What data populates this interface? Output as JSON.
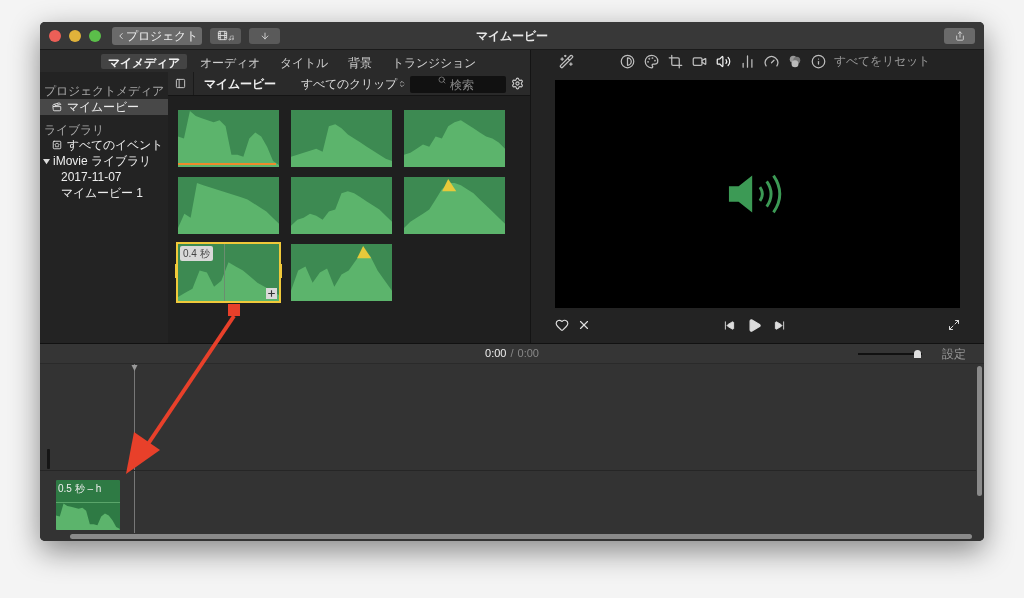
{
  "window": {
    "title": "マイムービー"
  },
  "toolbar": {
    "back_button": "プロジェクト"
  },
  "tabs": [
    {
      "label": "マイメディア",
      "selected": true
    },
    {
      "label": "オーディオ",
      "selected": false
    },
    {
      "label": "タイトル",
      "selected": false
    },
    {
      "label": "背景",
      "selected": false
    },
    {
      "label": "トランジション",
      "selected": false
    }
  ],
  "sidebar": {
    "project_heading": "プロジェクトメディア",
    "project_items": [
      {
        "label": "マイムービー",
        "selected": true
      }
    ],
    "library_heading": "ライブラリ",
    "events_item": {
      "label": "すべてのイベント",
      "selected": false
    },
    "tree": [
      {
        "label": "iMovie ライブラリ",
        "expanded": true,
        "children": [
          {
            "label": "2017-11-07",
            "selected": false
          },
          {
            "label": "マイムービー 1",
            "selected": false
          }
        ]
      }
    ]
  },
  "browser": {
    "title": "マイムービー",
    "filter": "すべてのクリップ",
    "search": {
      "placeholder": "検索"
    },
    "clips": [
      {
        "selected": false,
        "used": true,
        "peaking": false
      },
      {
        "selected": false,
        "used": false,
        "peaking": false
      },
      {
        "selected": false,
        "used": false,
        "peaking": false
      },
      {
        "selected": false,
        "used": false,
        "peaking": false
      },
      {
        "selected": false,
        "used": false,
        "peaking": false
      },
      {
        "selected": false,
        "used": false,
        "peaking": true
      },
      {
        "selected": true,
        "used": false,
        "peaking": false,
        "duration": "0.4 秒"
      },
      {
        "selected": false,
        "used": false,
        "peaking": true
      }
    ]
  },
  "viewer": {
    "reset_button": "すべてをリセット",
    "favorite": false
  },
  "timeline": {
    "current_time": "0:00",
    "separator": "/",
    "total_time": "0:00",
    "zoom": {
      "level": 0.93
    },
    "settings_button": "設定",
    "clips": [
      {
        "label": "0.5 秒 – h"
      }
    ]
  }
}
